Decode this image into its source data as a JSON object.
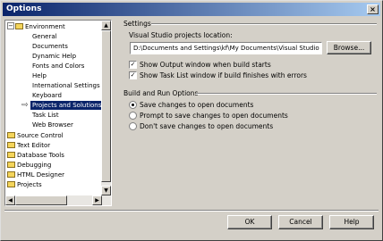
{
  "window": {
    "title": "Options",
    "close_glyph": "×"
  },
  "tree": {
    "nodes": [
      {
        "label": "Environment",
        "expander": "−"
      },
      {
        "label": "General"
      },
      {
        "label": "Documents"
      },
      {
        "label": "Dynamic Help"
      },
      {
        "label": "Fonts and Colors"
      },
      {
        "label": "Help"
      },
      {
        "label": "International Settings"
      },
      {
        "label": "Keyboard"
      },
      {
        "label": "Projects and Solutions"
      },
      {
        "label": "Task List"
      },
      {
        "label": "Web Browser"
      },
      {
        "label": "Source Control"
      },
      {
        "label": "Text Editor"
      },
      {
        "label": "Database Tools"
      },
      {
        "label": "Debugging"
      },
      {
        "label": "HTML Designer"
      },
      {
        "label": "Projects"
      }
    ],
    "arrow_glyph": "⇨",
    "scroll_up": "▲",
    "scroll_down": "▼",
    "scroll_left": "◀",
    "scroll_right": "▶"
  },
  "settings": {
    "heading": "Settings",
    "location_label": "Visual Studio projects location:",
    "location_value": "D:\\Documents and Settings\\kf\\My Documents\\Visual Studio P",
    "browse_label": "Browse...",
    "show_output": {
      "label": "Show Output window when build starts",
      "checked": true
    },
    "show_tasklist": {
      "label": "Show Task List window if build finishes with errors",
      "checked": true
    }
  },
  "build": {
    "heading": "Build and Run Options",
    "options": [
      {
        "label": "Save changes to open documents",
        "selected": true
      },
      {
        "label": "Prompt to save changes to open documents",
        "selected": false
      },
      {
        "label": "Don't save changes to open documents",
        "selected": false
      }
    ]
  },
  "buttons": {
    "ok": "OK",
    "cancel": "Cancel",
    "help": "Help"
  },
  "colors": {
    "titlebar_start": "#0a246a",
    "titlebar_end": "#a6caf0",
    "selection": "#0a246a",
    "face": "#d4d0c8"
  }
}
